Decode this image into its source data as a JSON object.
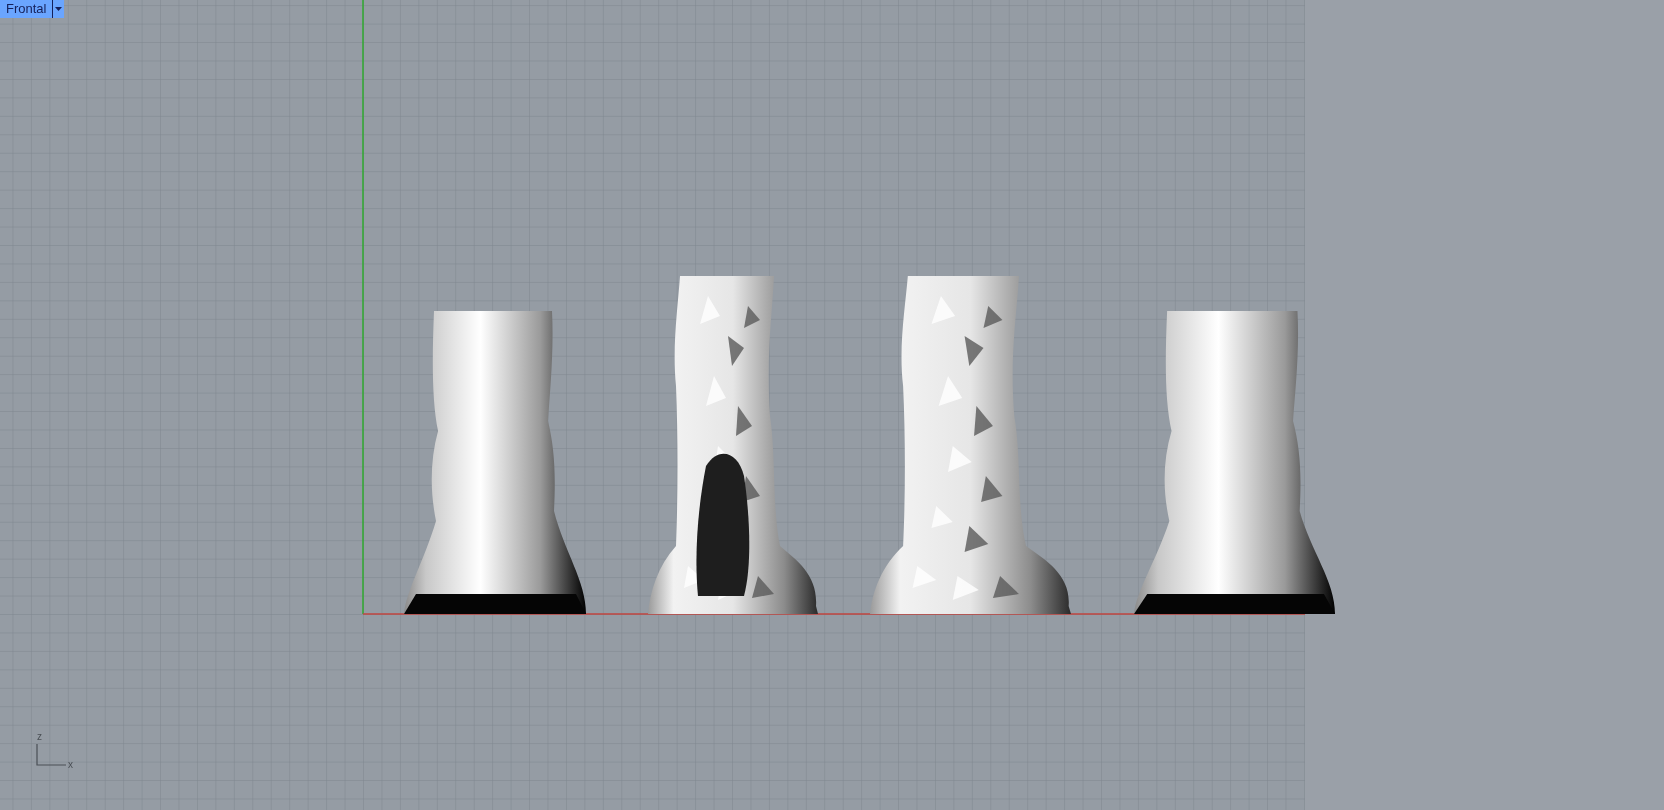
{
  "viewport_tab": {
    "label": "Frontal",
    "active": true
  },
  "axis_icon": {
    "vertical_label": "z",
    "horizontal_label": "x"
  },
  "objects": [
    {
      "kind": "smooth"
    },
    {
      "kind": "mesh"
    },
    {
      "kind": "mesh"
    },
    {
      "kind": "smooth"
    }
  ]
}
